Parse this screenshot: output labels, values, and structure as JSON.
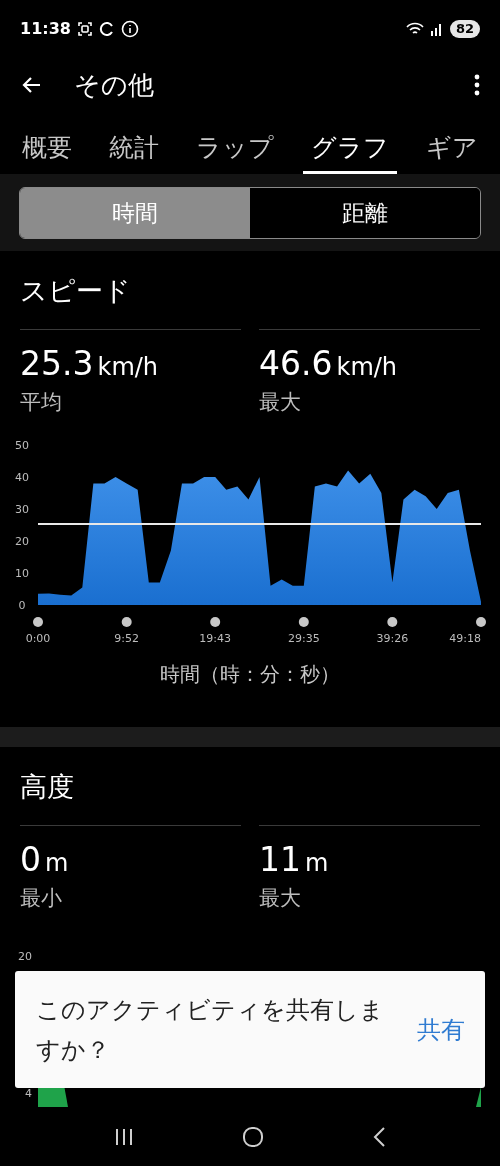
{
  "status_bar": {
    "time": "11:38",
    "battery": "82"
  },
  "header": {
    "title": "その他"
  },
  "tabs": [
    {
      "label": "概要",
      "selected": false
    },
    {
      "label": "統計",
      "selected": false
    },
    {
      "label": "ラップ",
      "selected": false
    },
    {
      "label": "グラフ",
      "selected": true
    },
    {
      "label": "ギア",
      "selected": false
    }
  ],
  "segments": [
    {
      "label": "時間",
      "selected": true
    },
    {
      "label": "距離",
      "selected": false
    }
  ],
  "speed": {
    "title": "スピード",
    "stats": [
      {
        "value": "25.3",
        "unit": "km/h",
        "label": "平均"
      },
      {
        "value": "46.6",
        "unit": "km/h",
        "label": "最大"
      }
    ],
    "chart_data": {
      "type": "area",
      "xlabel": "時間（時：分：秒）",
      "ylim": [
        0,
        50
      ],
      "yticks": [
        0,
        10,
        20,
        30,
        40,
        50
      ],
      "xlim": [
        0,
        49.3
      ],
      "xticks": [
        {
          "value": 0,
          "label": "0:00"
        },
        {
          "value": 9.87,
          "label": "9:52"
        },
        {
          "value": 19.72,
          "label": "19:43"
        },
        {
          "value": 29.58,
          "label": "29:35"
        },
        {
          "value": 39.43,
          "label": "39:26"
        },
        {
          "value": 49.3,
          "label": "49:18"
        }
      ],
      "x": [
        0,
        1.23,
        2.47,
        3.7,
        4.93,
        6.16,
        7.4,
        8.63,
        9.86,
        11.09,
        12.33,
        13.56,
        14.79,
        16.02,
        17.26,
        18.49,
        19.72,
        20.95,
        22.19,
        23.42,
        24.65,
        25.88,
        27.12,
        28.35,
        29.58,
        30.81,
        32.05,
        33.28,
        34.51,
        35.74,
        36.98,
        38.21,
        39.44,
        40.67,
        41.91,
        43.14,
        44.37,
        45.6,
        46.84,
        48.07,
        49.3
      ],
      "series": [
        {
          "color": "#3d8fe8",
          "values": [
            3.5,
            3.6,
            3.2,
            3,
            5.5,
            38,
            38,
            40,
            38,
            36,
            7,
            7,
            17,
            38,
            38,
            40,
            40,
            36,
            37,
            33,
            40,
            6,
            8,
            6,
            6,
            37,
            38,
            37,
            42,
            38,
            41,
            35,
            7,
            33,
            36,
            34,
            30,
            35,
            36,
            17,
            1
          ]
        }
      ],
      "ref_lines": [
        {
          "axis": "y",
          "value": 25.3,
          "color": "#e8e8e8"
        }
      ]
    }
  },
  "altitude": {
    "title": "高度",
    "stats": [
      {
        "value": "0",
        "unit": "m",
        "label": "最小"
      },
      {
        "value": "11",
        "unit": "m",
        "label": "最大"
      }
    ],
    "axis_labels": [
      "20",
      "4"
    ]
  },
  "snackbar": {
    "message": "このアクティビティを共有しますか？",
    "action": "共有"
  }
}
